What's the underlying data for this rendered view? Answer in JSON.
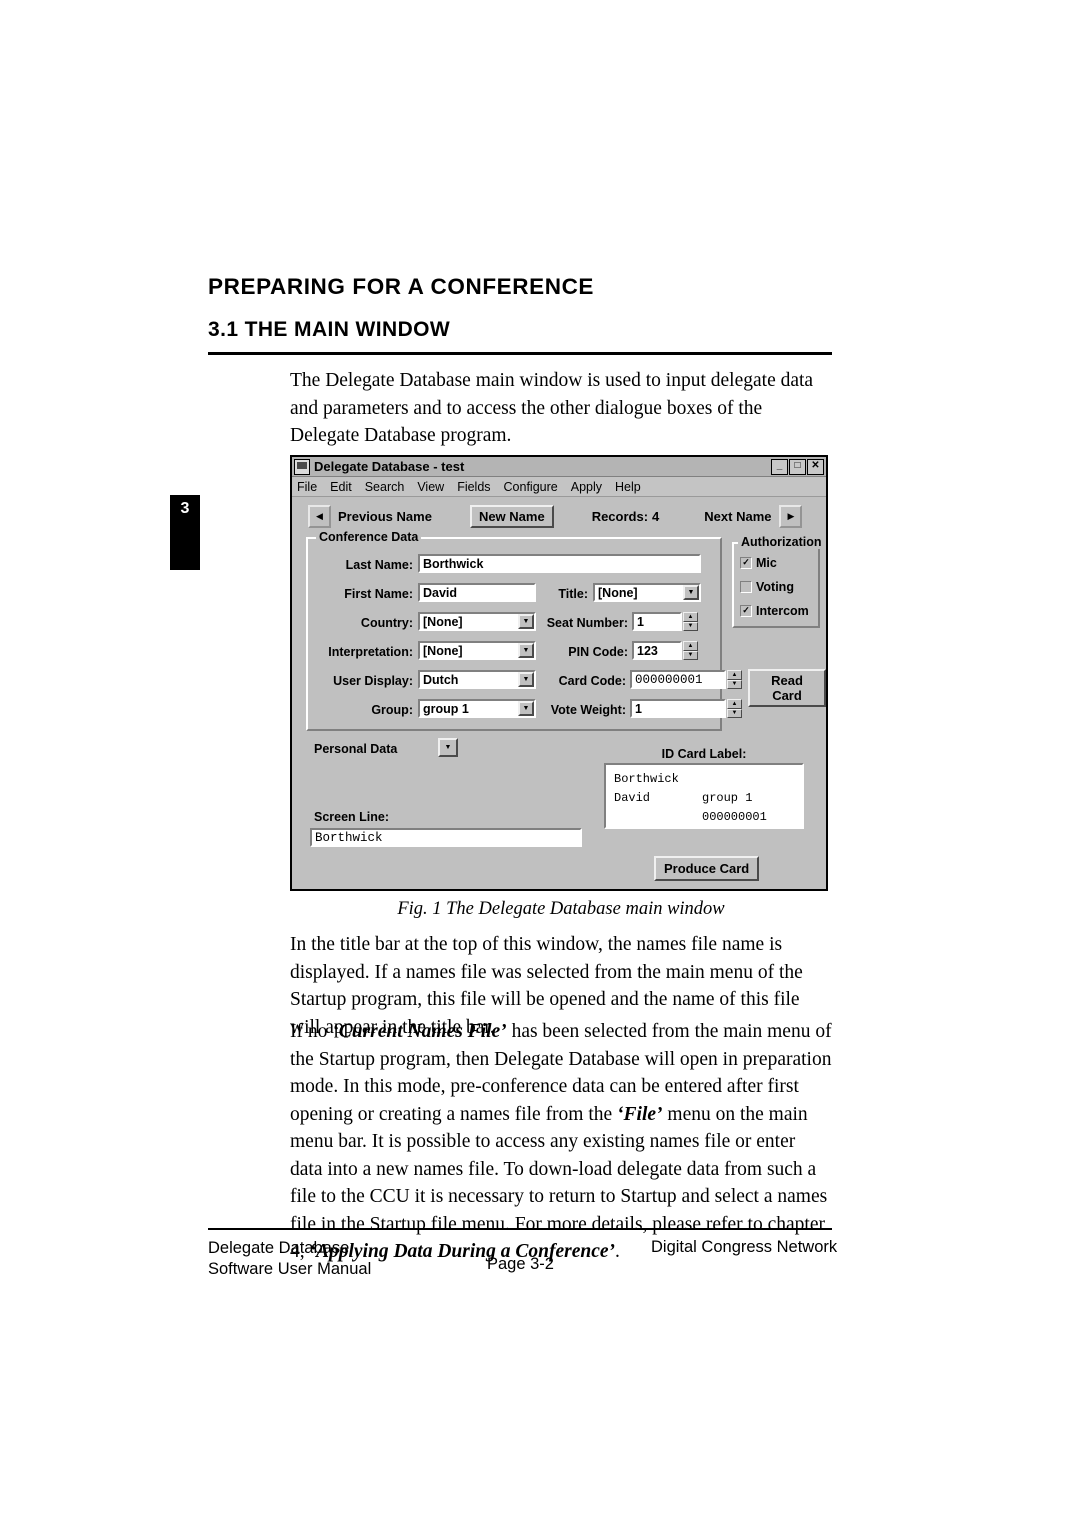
{
  "page": {
    "heading": "PREPARING FOR A CONFERENCE",
    "section_heading": "3.1 THE MAIN WINDOW",
    "chapter_tab": "3",
    "intro_paragraph": "The Delegate Database main window is used to input delegate data and parameters and to access the other dialogue boxes of the Delegate Database program.",
    "figure_caption": "Fig. 1 The Delegate Database main window",
    "paragraph_after_figure": "In the title bar at the top of this window, the names file name is displayed. If a names file was selected from the main menu of the Startup program, this file will be opened and the name of this file will appear in the title bar.",
    "footer": {
      "left_line1": "Delegate Database",
      "left_line2": "Software User Manual",
      "center": "Page 3-2",
      "right": "Digital Congress Network"
    }
  },
  "app": {
    "title": "Delegate Database - test",
    "title_icon": "application-icon",
    "window_buttons": [
      "minimize",
      "maximize",
      "close"
    ],
    "menu": [
      "File",
      "Edit",
      "Search",
      "View",
      "Fields",
      "Configure",
      "Apply",
      "Help"
    ],
    "nav": {
      "previous_label": "Previous Name",
      "new_name_button": "New Name",
      "records_label": "Records:",
      "records_value": "4",
      "next_label": "Next  Name",
      "prev_arrow": "left-arrow-icon",
      "next_arrow": "right-arrow-icon"
    },
    "conference_data": {
      "group_title": "Conference Data",
      "fields": {
        "last_name_label": "Last Name:",
        "last_name_value": "Borthwick",
        "first_name_label": "First Name:",
        "first_name_value": "David",
        "country_label": "Country:",
        "country_value": "[None]",
        "interpretation_label": "Interpretation:",
        "interpretation_value": "[None]",
        "user_display_label": "User Display:",
        "user_display_value": "Dutch",
        "group_label": "Group:",
        "group_value": "group 1",
        "title_label": "Title:",
        "title_value": "[None]",
        "seat_number_label": "Seat Number:",
        "seat_number_value": "1",
        "pin_code_label": "PIN Code:",
        "pin_code_value": "123",
        "card_code_label": "Card Code:",
        "card_code_value": "000000001",
        "vote_weight_label": "Vote Weight:",
        "vote_weight_value": "1",
        "read_card_button": "Read Card"
      }
    },
    "authorization": {
      "group_title": "Authorization",
      "items": [
        {
          "label": "Mic",
          "checked": true
        },
        {
          "label": "Voting",
          "checked": false
        },
        {
          "label": "Intercom",
          "checked": true
        }
      ]
    },
    "personal_data_label": "Personal Data",
    "screen_line_label": "Screen Line:",
    "screen_line_value": "Borthwick",
    "id_card_label": "ID Card Label:",
    "id_card": {
      "line1": "Borthwick",
      "line2_left": "David",
      "line2_right": "group 1",
      "line3_right": "000000001"
    },
    "produce_card_button": "Produce Card"
  },
  "colors": {
    "window_face": "#c0c0c0",
    "field_bg": "#ffffff",
    "text": "#000000"
  }
}
